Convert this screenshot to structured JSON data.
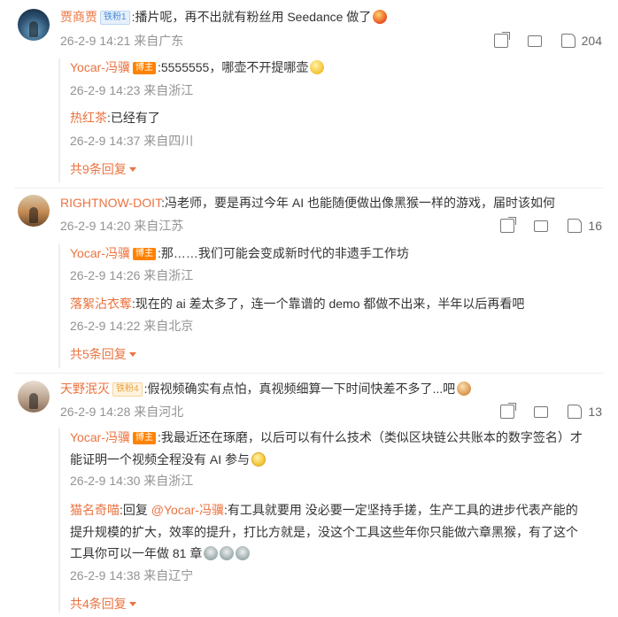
{
  "comments": [
    {
      "user": "贾商贾",
      "badge": "铁粉1",
      "text": ":播片呢，再不出就有粉丝用 Seedance 做了",
      "time": "26-2-9 14:21",
      "loc": "来自广东",
      "likes": "204",
      "replies": [
        {
          "user": "Yocar-冯骥",
          "badge": "博主",
          "text": ":5555555，哪壶不开提哪壶",
          "time": "26-2-9 14:23",
          "loc": "来自浙江"
        },
        {
          "user": "热红茶",
          "text": ":已经有了",
          "time": "26-2-9 14:37",
          "loc": "来自四川"
        }
      ],
      "more": "共9条回复"
    },
    {
      "user": "RIGHTNOW-DOIT",
      "text": ":冯老师，要是再过今年 AI 也能随便做出像黑猴一样的游戏，届时该如何",
      "time": "26-2-9 14:20",
      "loc": "来自江苏",
      "likes": "16",
      "replies": [
        {
          "user": "Yocar-冯骥",
          "badge": "博主",
          "text": ":那……我们可能会变成新时代的非遗手工作坊",
          "time": "26-2-9 14:26",
          "loc": "来自浙江"
        },
        {
          "user": "落絮沾衣奪",
          "text": ":现在的 ai 差太多了，连一个靠谱的 demo 都做不出来，半年以后再看吧",
          "time": "26-2-9 14:22",
          "loc": "来自北京"
        }
      ],
      "more": "共5条回复"
    },
    {
      "user": "天野泯灭",
      "badge": "铁粉4",
      "text": ":假视频确实有点怕，真视频细算一下时间快差不多了...吧",
      "time": "26-2-9 14:28",
      "loc": "来自河北",
      "likes": "13",
      "replies": [
        {
          "user": "Yocar-冯骥",
          "badge": "博主",
          "text_l1": ":我最近还在琢磨，以后可以有什么技术（类似区块链公共账本的数字签名）才",
          "text_l2": "能证明一个视频全程没有 AI 参与",
          "time": "26-2-9 14:30",
          "loc": "来自浙江"
        },
        {
          "user": "猫名奇喵",
          "reply_prefix": ":回复 ",
          "reply_to": "@Yocar-冯骥",
          "text_l1": ":有工具就要用 没必要一定坚持手搓，生产工具的进步代表产能的",
          "text_l2": "提升规模的扩大，效率的提升，打比方就是，没这个工具这些年你只能做六章黑猴，有了这个",
          "text_l3": "工具你可以一年做 81 章",
          "time": "26-2-9 14:38",
          "loc": "来自辽宁"
        }
      ],
      "more": "共4条回复"
    }
  ]
}
